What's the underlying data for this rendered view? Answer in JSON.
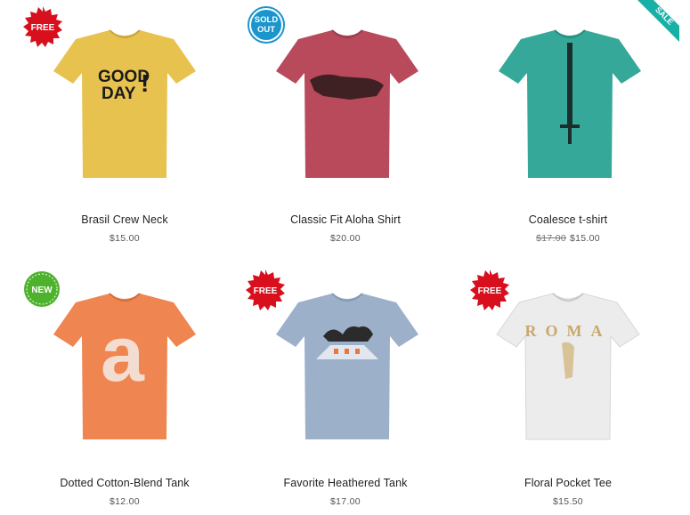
{
  "products": [
    {
      "name": "Brasil Crew Neck",
      "price": "$15.00",
      "badge": "FREE",
      "shirt_color": "#e8c24f"
    },
    {
      "name": "Classic Fit Aloha Shirt",
      "price": "$20.00",
      "badge": "SOLD OUT",
      "shirt_color": "#b84a5b"
    },
    {
      "name": "Coalesce t-shirt",
      "old_price": "$17.00",
      "price": "$15.00",
      "badge": "SALE",
      "shirt_color": "#35a89a"
    },
    {
      "name": "Dotted Cotton-Blend Tank",
      "price": "$12.00",
      "badge": "NEW",
      "shirt_color": "#ef8550"
    },
    {
      "name": "Favorite Heathered Tank",
      "price": "$17.00",
      "badge": "FREE",
      "shirt_color": "#9db0c9"
    },
    {
      "name": "Floral Pocket Tee",
      "price": "$15.50",
      "badge": "FREE",
      "shirt_color": "#ececec"
    }
  ],
  "prints": {
    "good_day_line1": "GOOD",
    "good_day_line2": "DAY",
    "good_day_mark": "!",
    "big_letter": "a",
    "roma": "ROMA"
  },
  "colors": {
    "badge_free": "#d8101e",
    "badge_sold_out": "#1c95cc",
    "badge_sale": "#17b0a7",
    "badge_new": "#4db22c"
  }
}
